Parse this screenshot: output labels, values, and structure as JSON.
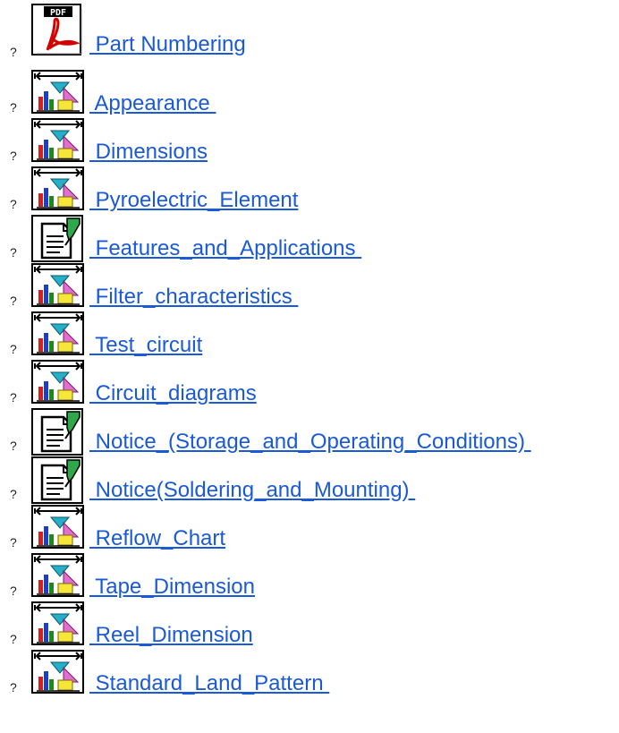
{
  "links": [
    {
      "bullet": "?",
      "icon": "pdf-icon",
      "label": " Part Numbering"
    },
    {
      "bullet": "?",
      "icon": "chart-icon",
      "label": " Appearance "
    },
    {
      "bullet": "?",
      "icon": "chart-icon",
      "label": " Dimensions"
    },
    {
      "bullet": "?",
      "icon": "chart-icon",
      "label": " Pyroelectric_Element"
    },
    {
      "bullet": "?",
      "icon": "document-icon",
      "label": " Features_and_Applications "
    },
    {
      "bullet": "?",
      "icon": "chart-icon",
      "label": " Filter_characteristics "
    },
    {
      "bullet": "?",
      "icon": "chart-icon",
      "label": " Test_circuit"
    },
    {
      "bullet": "?",
      "icon": "chart-icon",
      "label": " Circuit_diagrams"
    },
    {
      "bullet": "?",
      "icon": "document-icon",
      "label": " Notice_(Storage_and_Operating_Conditions) "
    },
    {
      "bullet": "?",
      "icon": "document-icon",
      "label": " Notice(Soldering_and_Mounting) "
    },
    {
      "bullet": "?",
      "icon": "chart-icon",
      "label": " Reflow_Chart"
    },
    {
      "bullet": "?",
      "icon": "chart-icon",
      "label": " Tape_Dimension"
    },
    {
      "bullet": "?",
      "icon": "chart-icon",
      "label": " Reel_Dimension"
    },
    {
      "bullet": "?",
      "icon": "chart-icon",
      "label": " Standard_Land_Pattern "
    }
  ],
  "colors": {
    "link": "#1a5ad6",
    "icon_border": "#000000"
  }
}
